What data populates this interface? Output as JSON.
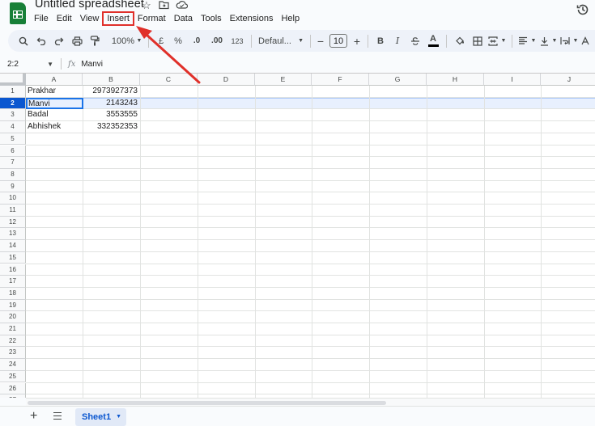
{
  "app": {
    "doc_title": "Untitled spreadsheet"
  },
  "menu": {
    "items": [
      {
        "label": "File",
        "name": "menu-file"
      },
      {
        "label": "Edit",
        "name": "menu-edit"
      },
      {
        "label": "View",
        "name": "menu-view"
      },
      {
        "label": "Insert",
        "name": "menu-insert",
        "highlight": true
      },
      {
        "label": "Format",
        "name": "menu-format"
      },
      {
        "label": "Data",
        "name": "menu-data"
      },
      {
        "label": "Tools",
        "name": "menu-tools"
      },
      {
        "label": "Extensions",
        "name": "menu-extensions"
      },
      {
        "label": "Help",
        "name": "menu-help"
      }
    ],
    "highlight_color": "#e0302a"
  },
  "toolbar": {
    "zoom": "100%",
    "currency": "£",
    "percent": "%",
    "decrease_decimal": ".0",
    "increase_decimal": ".00",
    "more_formats": "123",
    "font": "Defaul...",
    "font_size": "10",
    "minus": "−",
    "plus": "+",
    "bold": "B",
    "italic": "I",
    "text_color_letter": "A"
  },
  "formula_bar": {
    "name_box": "2:2",
    "fx": "fx",
    "value": "Manvi"
  },
  "grid": {
    "columns": [
      "A",
      "B",
      "C",
      "D",
      "E",
      "F",
      "G",
      "H",
      "I",
      "J"
    ],
    "rows": [
      "1",
      "2",
      "3",
      "4",
      "5",
      "6",
      "7",
      "8",
      "9",
      "10",
      "11",
      "12",
      "13",
      "14",
      "15",
      "16",
      "17",
      "18",
      "19",
      "20",
      "21",
      "22",
      "23",
      "24",
      "25",
      "26",
      "27"
    ],
    "active_row": "2",
    "data": [
      {
        "a": "Prakhar",
        "b": "2973927373"
      },
      {
        "a": "Manvi",
        "b": "2143243"
      },
      {
        "a": "Badal",
        "b": "3553555"
      },
      {
        "a": "Abhishek",
        "b": "332352353"
      }
    ],
    "selection_color": "#1a73e8"
  },
  "sheets": {
    "add_label": "+",
    "tabs": [
      {
        "label": "Sheet1",
        "active": true
      }
    ]
  },
  "annotation": {
    "arrow_color": "#e0302a"
  }
}
